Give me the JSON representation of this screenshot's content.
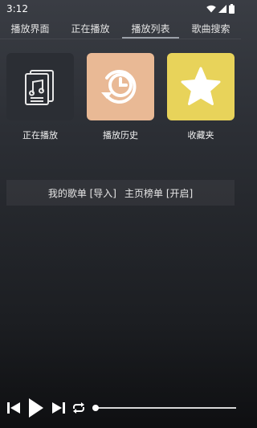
{
  "status_bar": {
    "time": "3:12"
  },
  "tabs": [
    {
      "label": "播放界面"
    },
    {
      "label": "正在播放"
    },
    {
      "label": "播放列表"
    },
    {
      "label": "歌曲搜索"
    }
  ],
  "active_tab": 2,
  "tiles": [
    {
      "label": "正在播放",
      "icon": "music-document-icon",
      "color": "#2b2e34"
    },
    {
      "label": "播放历史",
      "icon": "history-clock-icon",
      "color": "#e9b995"
    },
    {
      "label": "收藏夹",
      "icon": "star-icon",
      "color": "#e8d35a"
    }
  ],
  "playlist_bar": {
    "my_songs": "我的歌单 [导入]",
    "home_chart": "主页榜单 [开启]"
  },
  "player": {
    "progress": 0
  }
}
